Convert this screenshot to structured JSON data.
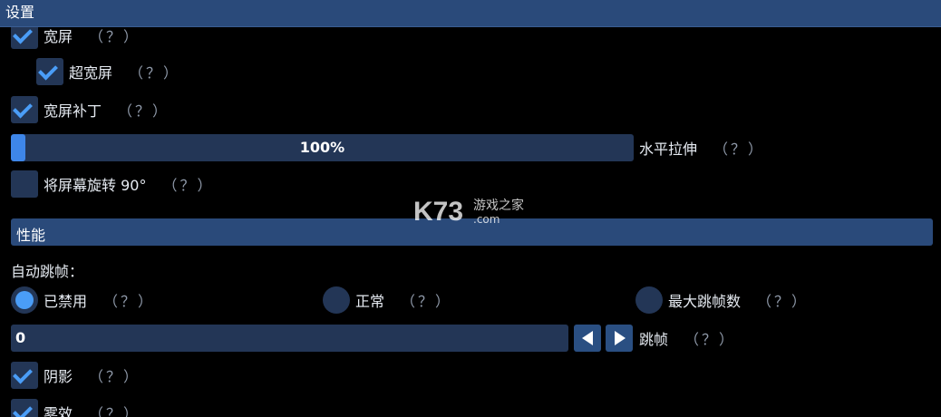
{
  "window": {
    "title": "设置"
  },
  "help_text": "（？）",
  "display": {
    "widescreen": {
      "label": "宽屏",
      "checked": true
    },
    "ultrawide": {
      "label": "超宽屏",
      "checked": true
    },
    "widescreen_patch": {
      "label": "宽屏补丁",
      "checked": true
    },
    "horizontal_stretch": {
      "value_text": "100%",
      "fill_fraction": 0.02,
      "label": "水平拉伸"
    },
    "rotate_screen": {
      "label": "将屏幕旋转 90°",
      "checked": false
    }
  },
  "performance": {
    "header": "性能",
    "auto_frameskip_label": "自动跳帧：",
    "options": [
      {
        "label": "已禁用",
        "selected": true
      },
      {
        "label": "正常",
        "selected": false
      },
      {
        "label": "最大跳帧数",
        "selected": false
      }
    ],
    "frameskip": {
      "value_text": "0",
      "label": "跳帧"
    },
    "shadows": {
      "label": "阴影",
      "checked": true
    },
    "fog": {
      "label": "雾效",
      "checked": true
    }
  },
  "watermark": {
    "logo_text": "K73",
    "site_name": "游戏之家",
    "domain": ".com"
  },
  "colors": {
    "accent": "#4a9df7",
    "panel": "#233656",
    "header": "#2a4a7a",
    "background": "#000000"
  }
}
